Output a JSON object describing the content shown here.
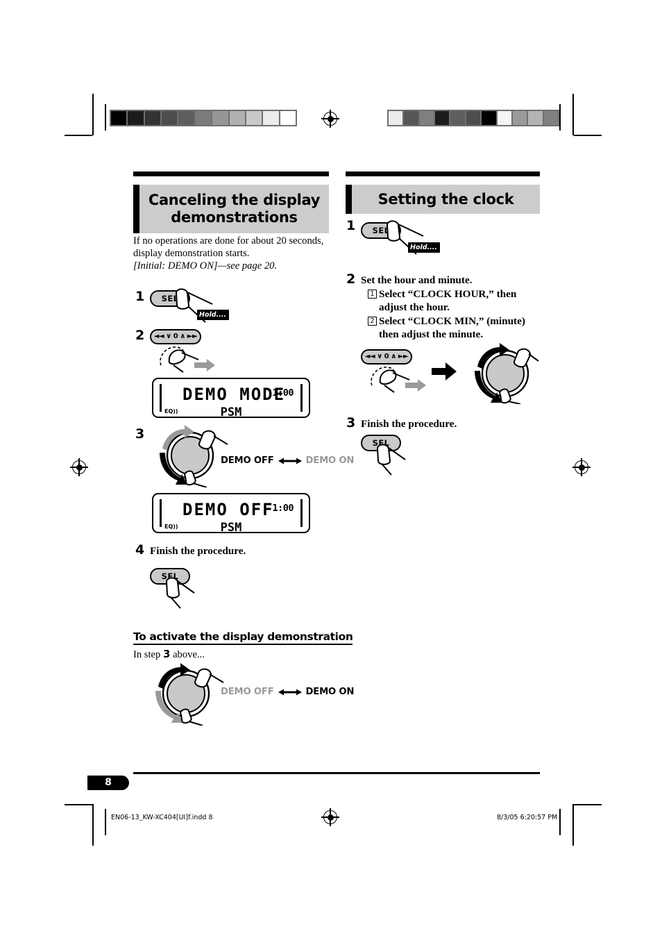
{
  "page": {
    "number": "8",
    "footer_left": "EN06-13_KW-XC404[UI]f.indd   8",
    "footer_right": "8/3/05   6:20:57 PM"
  },
  "registration": {
    "left_wedge_colors": [
      "#000000",
      "#1b1b1b",
      "#333333",
      "#4d4d4d",
      "#5e5e5e",
      "#7b7b7b",
      "#969696",
      "#b0b0b0",
      "#c9c9c9",
      "#ececec",
      "#ffffff"
    ],
    "right_wedge_colors": [
      "#ececec",
      "#555555",
      "#808080",
      "#1c1c1c",
      "#5e5e5e",
      "#4d4d4d",
      "#000000",
      "#f4f4f4",
      "#9a9a9a",
      "#b4b4b4",
      "#808080"
    ]
  },
  "left_column": {
    "heading": "Canceling the display demonstrations",
    "intro_line1": "If no operations are done for about 20 seconds,",
    "intro_line2": "display demonstration starts.",
    "intro_line3": "[Initial: DEMO ON]—see page 20.",
    "step1": {
      "number": "1",
      "button_label": "SEL",
      "hold_label": "Hold...."
    },
    "step2": {
      "number": "2",
      "button_label": "◄◄ ∨ 0 ∧ ►►"
    },
    "lcd1": {
      "main": "DEMO MODE",
      "clock": "1:00",
      "sub": "PSM",
      "eq": "EQ"
    },
    "step3": {
      "number": "3",
      "toggle_left": "DEMO OFF",
      "toggle_arrow": "◄—►",
      "toggle_right": "DEMO ON"
    },
    "lcd2": {
      "main": "DEMO OFF",
      "clock": "1:00",
      "sub": "PSM",
      "eq": "EQ"
    },
    "step4": {
      "number": "4",
      "text": "Finish the procedure.",
      "button_label": "SEL"
    },
    "activate": {
      "heading": "To activate the display demonstration",
      "instruction_pre": "In step",
      "instruction_num": "3",
      "instruction_post": "above...",
      "toggle_left": "DEMO OFF",
      "toggle_arrow": "◄—►",
      "toggle_right": "DEMO ON"
    }
  },
  "right_column": {
    "heading": "Setting the clock",
    "step1": {
      "number": "1",
      "button_label": "SEL",
      "hold_label": "Hold...."
    },
    "step2": {
      "number": "2",
      "text": "Set the hour and minute.",
      "sub1_num": "1",
      "sub1_line1": "Select “CLOCK HOUR,” then",
      "sub1_line2": "adjust the hour.",
      "sub2_num": "2",
      "sub2_line1": "Select “CLOCK MIN,” (minute)",
      "sub2_line2": "then adjust the minute.",
      "button_label": "◄◄ ∨ 0 ∧ ►►"
    },
    "step3": {
      "number": "3",
      "text": "Finish the procedure.",
      "button_label": "SEL"
    }
  }
}
